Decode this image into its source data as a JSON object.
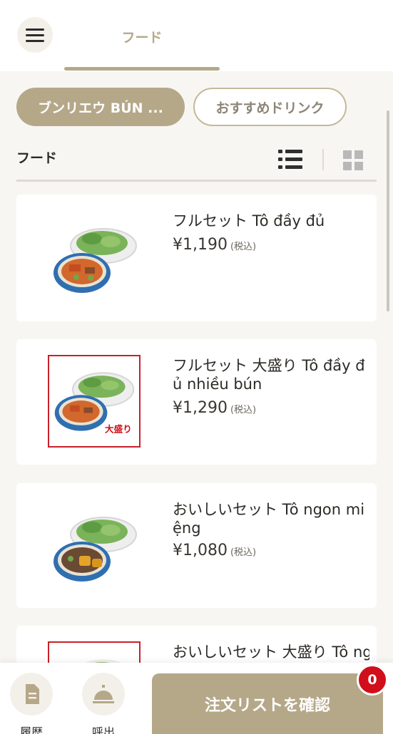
{
  "header": {
    "menu_icon": "hamburger-menu-icon",
    "active_tab": "フード"
  },
  "categories": [
    {
      "label": "ブンリエウ BÚN ...",
      "active": true
    },
    {
      "label": "おすすめドリンク",
      "active": false
    }
  ],
  "section": {
    "title": "フード",
    "view_modes": [
      "list-view-icon",
      "grid-view-icon"
    ],
    "active_view": "list"
  },
  "products": [
    {
      "name": "フルセット Tô đầy đủ",
      "price": "¥1,190",
      "tax": "(税込)",
      "image_label": ""
    },
    {
      "name": "フルセット 大盛り Tô đầy đủ nhiều bún",
      "price": "¥1,290",
      "tax": "(税込)",
      "image_label": "大盛り"
    },
    {
      "name": "おいしいセット Tô ngon miệng",
      "price": "¥1,080",
      "tax": "(税込)",
      "image_label": ""
    },
    {
      "name": "おいしいセット 大盛り Tô ng",
      "price": "",
      "tax": "",
      "image_label": ""
    }
  ],
  "bottom_bar": {
    "history_label": "履歴",
    "history_icon": "document-icon",
    "call_label": "呼出",
    "call_icon": "service-bell-icon",
    "confirm_label": "注文リストを確認",
    "cart_count": "0"
  },
  "colors": {
    "accent": "#b5a889",
    "badge": "#d10f1a",
    "background": "#f8f6f2"
  }
}
